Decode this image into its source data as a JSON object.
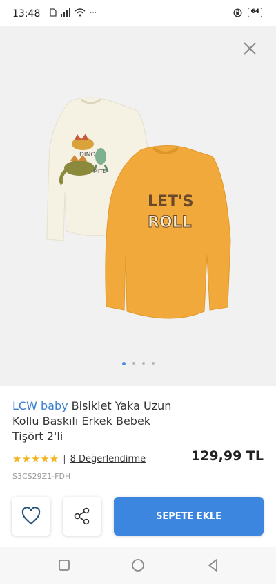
{
  "status_bar": {
    "time": "13:48",
    "battery": "64",
    "icons": [
      "sim-icon",
      "signal-icon",
      "wifi-icon",
      "alarm-icon",
      "battery-icon"
    ]
  },
  "gallery": {
    "close_icon": "close-icon",
    "image_description_icon": "product-photo",
    "active_index": 0,
    "dot_count": 4
  },
  "product": {
    "brand": "LCW baby",
    "title": "Bisiklet Yaka Uzun Kollu Baskılı Erkek Bebek Tişört 2'li",
    "price": "129,99 TL",
    "rating_stars": "★★★★★",
    "rating_value": 5,
    "reviews": "8 Değerlendirme",
    "sku": "S3CS29Z1-FDH"
  },
  "actions": {
    "favorite_icon": "heart-icon",
    "share_icon": "share-icon",
    "cart_label": "SEPETE EKLE"
  },
  "colors": {
    "brand": "#3b7ecf",
    "cart_button": "#3d86e0",
    "stars": "#f2b51f",
    "gallery_bg": "#f1f1f1"
  },
  "nav_bar": {
    "icons": [
      "recent-apps-icon",
      "home-icon",
      "back-icon"
    ]
  }
}
